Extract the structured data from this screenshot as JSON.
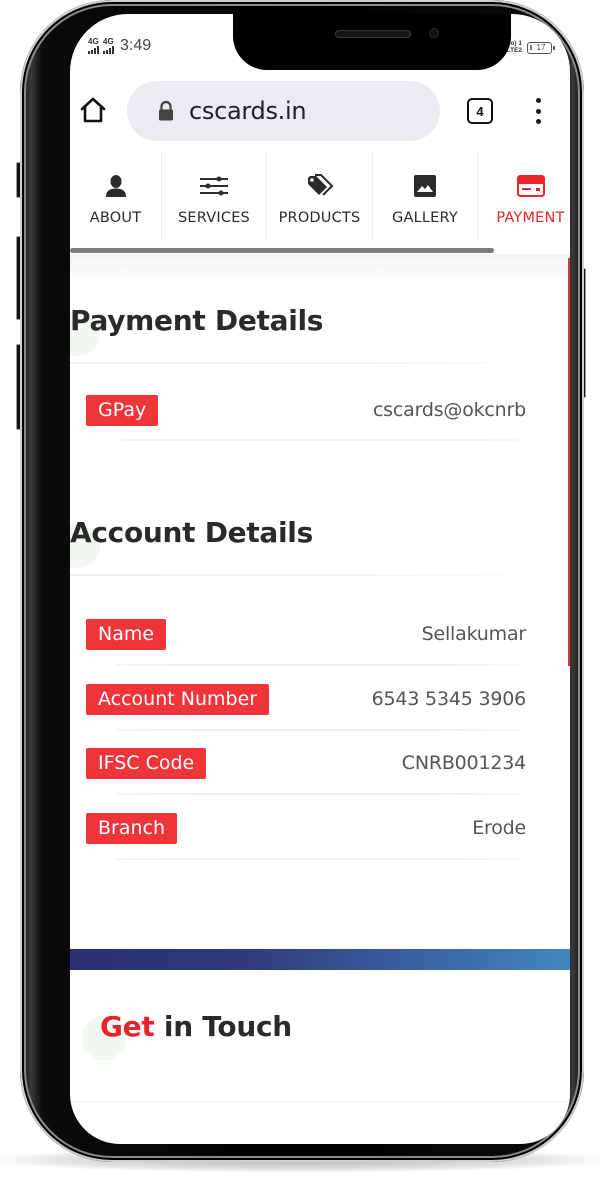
{
  "status_bar": {
    "sim1_network": "4G",
    "sim2_network": "4G",
    "time": "3:49",
    "volte_line1": "Vo) 1",
    "volte_line2": "LTE2",
    "battery_level": "17"
  },
  "browser": {
    "url": "cscards.in",
    "tab_count": "4",
    "icons": {
      "home": "home-icon",
      "lock": "lock-icon",
      "tabs": "tab-switcher-icon",
      "menu": "more-vert-icon"
    }
  },
  "nav": {
    "items": [
      {
        "label": "ABOUT",
        "icon": "person-icon",
        "active": false
      },
      {
        "label": "SERVICES",
        "icon": "sliders-icon",
        "active": false
      },
      {
        "label": "PRODUCTS",
        "icon": "tags-icon",
        "active": false
      },
      {
        "label": "GALLERY",
        "icon": "image-icon",
        "active": false
      },
      {
        "label": "PAYMENT",
        "icon": "credit-card-icon",
        "active": true
      }
    ],
    "scroll_position_fraction": 0.85
  },
  "payment_details": {
    "title": "Payment Details",
    "rows": [
      {
        "label": "GPay",
        "value": "cscards@okcnrb"
      }
    ]
  },
  "account_details": {
    "title": "Account Details",
    "rows": [
      {
        "label": "Name",
        "value": "Sellakumar"
      },
      {
        "label": "Account Number",
        "value": "6543 5345 3906"
      },
      {
        "label": "IFSC Code",
        "value": "CNRB001234"
      },
      {
        "label": "Branch",
        "value": "Erode"
      }
    ]
  },
  "get_in_touch": {
    "highlight": "Get",
    "rest": " in Touch"
  },
  "colors": {
    "accent_red": "#e8242b",
    "label_red": "#f0353a",
    "band_start": "#2b2f73",
    "band_end": "#4386c2",
    "text_dark": "#2a2a2a"
  }
}
